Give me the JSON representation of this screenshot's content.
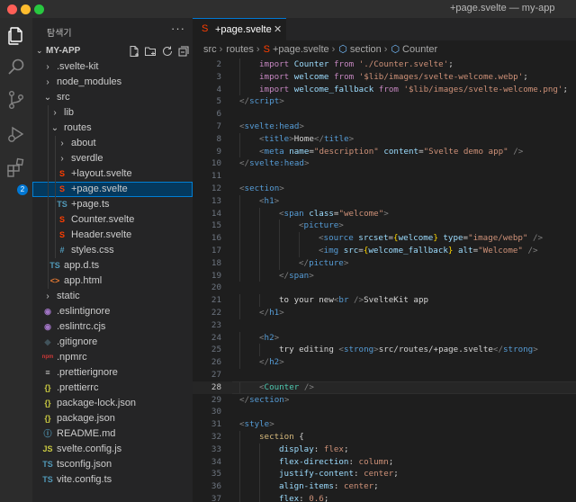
{
  "window": {
    "title": "+page.svelte — my-app"
  },
  "activity": {
    "extensions_badge": "2"
  },
  "sidebar": {
    "title": "탐색기",
    "more": "···",
    "project": "MY-APP",
    "tree": [
      {
        "label": ".svelte-kit",
        "depth": 0,
        "type": "folder",
        "open": false
      },
      {
        "label": "node_modules",
        "depth": 0,
        "type": "folder",
        "open": false
      },
      {
        "label": "src",
        "depth": 0,
        "type": "folder",
        "open": true
      },
      {
        "label": "lib",
        "depth": 1,
        "type": "folder",
        "open": false
      },
      {
        "label": "routes",
        "depth": 1,
        "type": "folder",
        "open": true
      },
      {
        "label": "about",
        "depth": 2,
        "type": "folder",
        "open": false
      },
      {
        "label": "sverdle",
        "depth": 2,
        "type": "folder",
        "open": false
      },
      {
        "label": "+layout.svelte",
        "depth": 2,
        "type": "svelte"
      },
      {
        "label": "+page.svelte",
        "depth": 2,
        "type": "svelte",
        "active": true
      },
      {
        "label": "+page.ts",
        "depth": 2,
        "type": "ts"
      },
      {
        "label": "Counter.svelte",
        "depth": 2,
        "type": "svelte"
      },
      {
        "label": "Header.svelte",
        "depth": 2,
        "type": "svelte"
      },
      {
        "label": "styles.css",
        "depth": 2,
        "type": "css"
      },
      {
        "label": "app.d.ts",
        "depth": 1,
        "type": "ts"
      },
      {
        "label": "app.html",
        "depth": 1,
        "type": "html"
      },
      {
        "label": "static",
        "depth": 0,
        "type": "folder",
        "open": false
      },
      {
        "label": ".eslintignore",
        "depth": 0,
        "type": "eslint"
      },
      {
        "label": ".eslintrc.cjs",
        "depth": 0,
        "type": "eslint"
      },
      {
        "label": ".gitignore",
        "depth": 0,
        "type": "git"
      },
      {
        "label": ".npmrc",
        "depth": 0,
        "type": "npm"
      },
      {
        "label": ".prettierignore",
        "depth": 0,
        "type": "prettier"
      },
      {
        "label": ".prettierrc",
        "depth": 0,
        "type": "json"
      },
      {
        "label": "package-lock.json",
        "depth": 0,
        "type": "json"
      },
      {
        "label": "package.json",
        "depth": 0,
        "type": "json"
      },
      {
        "label": "README.md",
        "depth": 0,
        "type": "info"
      },
      {
        "label": "svelte.config.js",
        "depth": 0,
        "type": "js"
      },
      {
        "label": "tsconfig.json",
        "depth": 0,
        "type": "tsjson"
      },
      {
        "label": "vite.config.ts",
        "depth": 0,
        "type": "ts"
      }
    ]
  },
  "editor": {
    "tab": {
      "label": "+page.svelte",
      "close": "✕"
    },
    "breadcrumbs": [
      "src",
      "routes",
      "+page.svelte",
      "section",
      "Counter"
    ],
    "current_line": 28,
    "lines": [
      {
        "n": 2,
        "indent": 1,
        "tokens": [
          [
            "kw",
            "import "
          ],
          [
            "var",
            "Counter"
          ],
          [
            "kw",
            " from "
          ],
          [
            "str",
            "'./Counter.svelte'"
          ],
          [
            "text",
            ";"
          ]
        ]
      },
      {
        "n": 3,
        "indent": 1,
        "tokens": [
          [
            "kw",
            "import "
          ],
          [
            "var",
            "welcome"
          ],
          [
            "kw",
            " from "
          ],
          [
            "str",
            "'$lib/images/svelte-welcome.webp'"
          ],
          [
            "text",
            ";"
          ]
        ]
      },
      {
        "n": 4,
        "indent": 1,
        "tokens": [
          [
            "kw",
            "import "
          ],
          [
            "var",
            "welcome_fallback"
          ],
          [
            "kw",
            " from "
          ],
          [
            "str",
            "'$lib/images/svelte-welcome.png'"
          ],
          [
            "text",
            ";"
          ]
        ]
      },
      {
        "n": 5,
        "indent": 0,
        "tokens": [
          [
            "punc",
            "</"
          ],
          [
            "tag",
            "script"
          ],
          [
            "punc",
            ">"
          ]
        ]
      },
      {
        "n": 6,
        "indent": 0,
        "tokens": []
      },
      {
        "n": 7,
        "indent": 0,
        "tokens": [
          [
            "punc",
            "<"
          ],
          [
            "tag",
            "svelte:head"
          ],
          [
            "punc",
            ">"
          ]
        ]
      },
      {
        "n": 8,
        "indent": 1,
        "tokens": [
          [
            "punc",
            "<"
          ],
          [
            "tag",
            "title"
          ],
          [
            "punc",
            ">"
          ],
          [
            "text",
            "Home"
          ],
          [
            "punc",
            "</"
          ],
          [
            "tag",
            "title"
          ],
          [
            "punc",
            ">"
          ]
        ]
      },
      {
        "n": 9,
        "indent": 1,
        "tokens": [
          [
            "punc",
            "<"
          ],
          [
            "tag",
            "meta "
          ],
          [
            "attr",
            "name"
          ],
          [
            "text",
            "="
          ],
          [
            "str",
            "\"description\" "
          ],
          [
            "attr",
            "content"
          ],
          [
            "text",
            "="
          ],
          [
            "str",
            "\"Svelte demo app\""
          ],
          [
            "punc",
            " />"
          ]
        ]
      },
      {
        "n": 10,
        "indent": 0,
        "tokens": [
          [
            "punc",
            "</"
          ],
          [
            "tag",
            "svelte:head"
          ],
          [
            "punc",
            ">"
          ]
        ]
      },
      {
        "n": 11,
        "indent": 0,
        "tokens": []
      },
      {
        "n": 12,
        "indent": 0,
        "tokens": [
          [
            "punc",
            "<"
          ],
          [
            "tag",
            "section"
          ],
          [
            "punc",
            ">"
          ]
        ]
      },
      {
        "n": 13,
        "indent": 1,
        "tokens": [
          [
            "punc",
            "<"
          ],
          [
            "tag",
            "h1"
          ],
          [
            "punc",
            ">"
          ]
        ]
      },
      {
        "n": 14,
        "indent": 2,
        "tokens": [
          [
            "punc",
            "<"
          ],
          [
            "tag",
            "span "
          ],
          [
            "attr",
            "class"
          ],
          [
            "text",
            "="
          ],
          [
            "str",
            "\"welcome\""
          ],
          [
            "punc",
            ">"
          ]
        ]
      },
      {
        "n": 15,
        "indent": 3,
        "tokens": [
          [
            "punc",
            "<"
          ],
          [
            "tag",
            "picture"
          ],
          [
            "punc",
            ">"
          ]
        ]
      },
      {
        "n": 16,
        "indent": 4,
        "tokens": [
          [
            "punc",
            "<"
          ],
          [
            "tag",
            "source "
          ],
          [
            "attr",
            "srcset"
          ],
          [
            "text",
            "="
          ],
          [
            "brace",
            "{"
          ],
          [
            "var",
            "welcome"
          ],
          [
            "brace",
            "}"
          ],
          [
            "attr",
            " type"
          ],
          [
            "text",
            "="
          ],
          [
            "str",
            "\"image/webp\""
          ],
          [
            "punc",
            " />"
          ]
        ]
      },
      {
        "n": 17,
        "indent": 4,
        "tokens": [
          [
            "punc",
            "<"
          ],
          [
            "tag",
            "img "
          ],
          [
            "attr",
            "src"
          ],
          [
            "text",
            "="
          ],
          [
            "brace",
            "{"
          ],
          [
            "var",
            "welcome_fallback"
          ],
          [
            "brace",
            "}"
          ],
          [
            "attr",
            " alt"
          ],
          [
            "text",
            "="
          ],
          [
            "str",
            "\"Welcome\""
          ],
          [
            "punc",
            " />"
          ]
        ]
      },
      {
        "n": 18,
        "indent": 3,
        "tokens": [
          [
            "punc",
            "</"
          ],
          [
            "tag",
            "picture"
          ],
          [
            "punc",
            ">"
          ]
        ]
      },
      {
        "n": 19,
        "indent": 2,
        "tokens": [
          [
            "punc",
            "</"
          ],
          [
            "tag",
            "span"
          ],
          [
            "punc",
            ">"
          ]
        ]
      },
      {
        "n": 20,
        "indent": 0,
        "tokens": []
      },
      {
        "n": 21,
        "indent": 2,
        "tokens": [
          [
            "text",
            "to your new"
          ],
          [
            "punc",
            "<"
          ],
          [
            "tag",
            "br"
          ],
          [
            "punc",
            " />"
          ],
          [
            "text",
            "SvelteKit app"
          ]
        ]
      },
      {
        "n": 22,
        "indent": 1,
        "tokens": [
          [
            "punc",
            "</"
          ],
          [
            "tag",
            "h1"
          ],
          [
            "punc",
            ">"
          ]
        ]
      },
      {
        "n": 23,
        "indent": 0,
        "tokens": []
      },
      {
        "n": 24,
        "indent": 1,
        "tokens": [
          [
            "punc",
            "<"
          ],
          [
            "tag",
            "h2"
          ],
          [
            "punc",
            ">"
          ]
        ]
      },
      {
        "n": 25,
        "indent": 2,
        "tokens": [
          [
            "text",
            "try editing "
          ],
          [
            "punc",
            "<"
          ],
          [
            "tag",
            "strong"
          ],
          [
            "punc",
            ">"
          ],
          [
            "text",
            "src/routes/+page.svelte"
          ],
          [
            "punc",
            "</"
          ],
          [
            "tag",
            "strong"
          ],
          [
            "punc",
            ">"
          ]
        ]
      },
      {
        "n": 26,
        "indent": 1,
        "tokens": [
          [
            "punc",
            "</"
          ],
          [
            "tag",
            "h2"
          ],
          [
            "punc",
            ">"
          ]
        ]
      },
      {
        "n": 27,
        "indent": 0,
        "tokens": []
      },
      {
        "n": 28,
        "indent": 1,
        "tokens": [
          [
            "punc",
            "<"
          ],
          [
            "comp",
            "Counter"
          ],
          [
            "punc",
            " />"
          ]
        ]
      },
      {
        "n": 29,
        "indent": 0,
        "tokens": [
          [
            "punc",
            "</"
          ],
          [
            "tag",
            "section"
          ],
          [
            "punc",
            ">"
          ]
        ]
      },
      {
        "n": 30,
        "indent": 0,
        "tokens": []
      },
      {
        "n": 31,
        "indent": 0,
        "tokens": [
          [
            "punc",
            "<"
          ],
          [
            "tag",
            "style"
          ],
          [
            "punc",
            ">"
          ]
        ]
      },
      {
        "n": 32,
        "indent": 1,
        "tokens": [
          [
            "sel",
            "section "
          ],
          [
            "text",
            "{"
          ]
        ]
      },
      {
        "n": 33,
        "indent": 2,
        "tokens": [
          [
            "prop",
            "display"
          ],
          [
            "text",
            ": "
          ],
          [
            "val",
            "flex"
          ],
          [
            "text",
            ";"
          ]
        ]
      },
      {
        "n": 34,
        "indent": 2,
        "tokens": [
          [
            "prop",
            "flex-direction"
          ],
          [
            "text",
            ": "
          ],
          [
            "val",
            "column"
          ],
          [
            "text",
            ";"
          ]
        ]
      },
      {
        "n": 35,
        "indent": 2,
        "tokens": [
          [
            "prop",
            "justify-content"
          ],
          [
            "text",
            ": "
          ],
          [
            "val",
            "center"
          ],
          [
            "text",
            ";"
          ]
        ]
      },
      {
        "n": 36,
        "indent": 2,
        "tokens": [
          [
            "prop",
            "align-items"
          ],
          [
            "text",
            ": "
          ],
          [
            "val",
            "center"
          ],
          [
            "text",
            ";"
          ]
        ]
      },
      {
        "n": 37,
        "indent": 2,
        "tokens": [
          [
            "prop",
            "flex"
          ],
          [
            "text",
            ": "
          ],
          [
            "val",
            "0.6"
          ],
          [
            "text",
            ";"
          ]
        ]
      }
    ]
  }
}
